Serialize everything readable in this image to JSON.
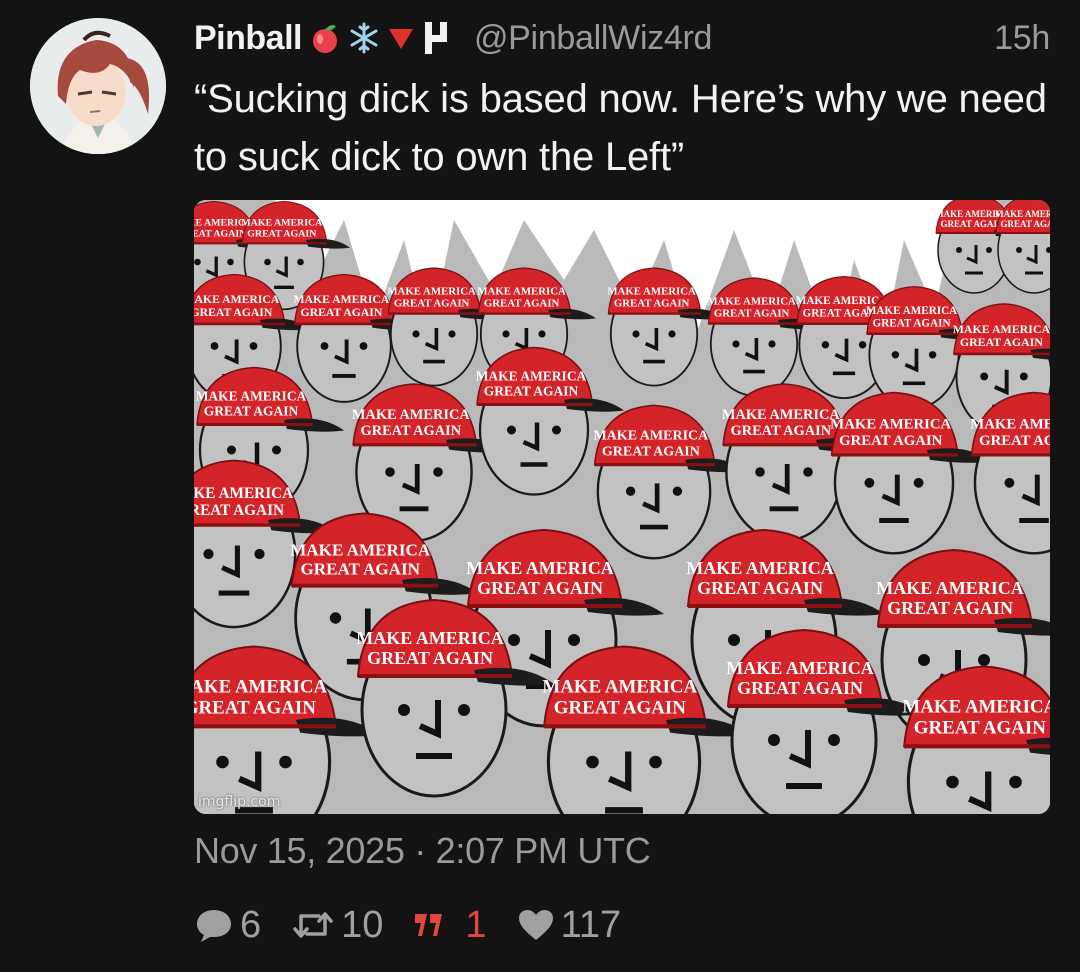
{
  "user": {
    "display_name": "Pinball",
    "handle": "@PinballWiz4rd",
    "badges": [
      "peach-icon",
      "snowflake-icon",
      "red-triangle-icon",
      "flag-letter-icon"
    ]
  },
  "post": {
    "relative_time": "15h",
    "text": "“Sucking dick is based now. Here’s why we need to suck dick to own the Left”",
    "timestamp": "Nov 15, 2025 · 2:07 PM UTC"
  },
  "media": {
    "cap_text_line1": "MAKE AMERICA",
    "cap_text_line2": "GREAT AGAIN",
    "watermark": "imgflip.com"
  },
  "actions": {
    "replies": "6",
    "retweets": "10",
    "quotes": "1",
    "likes": "117"
  },
  "colors": {
    "background": "#131313",
    "text": "#ececec",
    "muted": "#9a9a9a",
    "cap_red": "#d3242a",
    "quote_red": "#e0483f"
  }
}
